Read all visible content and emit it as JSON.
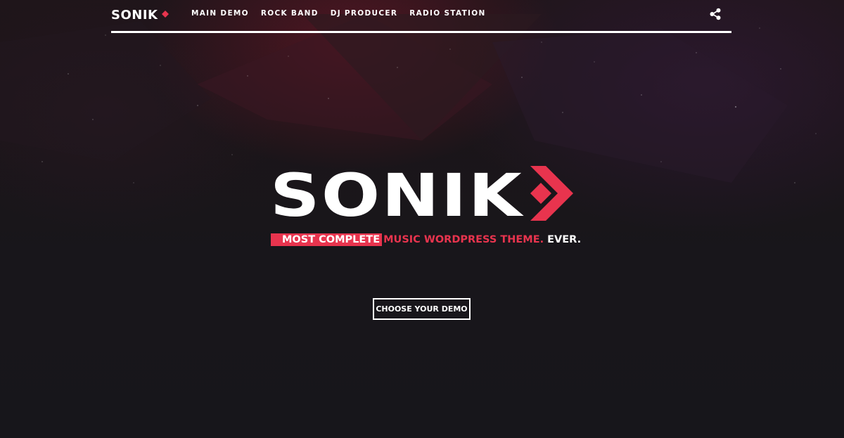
{
  "brand": {
    "name": "SONIK",
    "accent_color": "#e8344e",
    "text_color": "#ffffff"
  },
  "nav": {
    "items": [
      {
        "label": "MAIN DEMO"
      },
      {
        "label": "ROCK BAND"
      },
      {
        "label": "DJ PRODUCER"
      },
      {
        "label": "RADIO STATION"
      }
    ],
    "share_icon": "share-icon"
  },
  "hero": {
    "logo_text": "SONIK",
    "tagline_highlight": "MOST COMPLETE",
    "tagline_red": "MUSIC WORDPRESS THEME.",
    "tagline_white": "EVER.",
    "cta_label": "CHOOSE YOUR DEMO"
  }
}
